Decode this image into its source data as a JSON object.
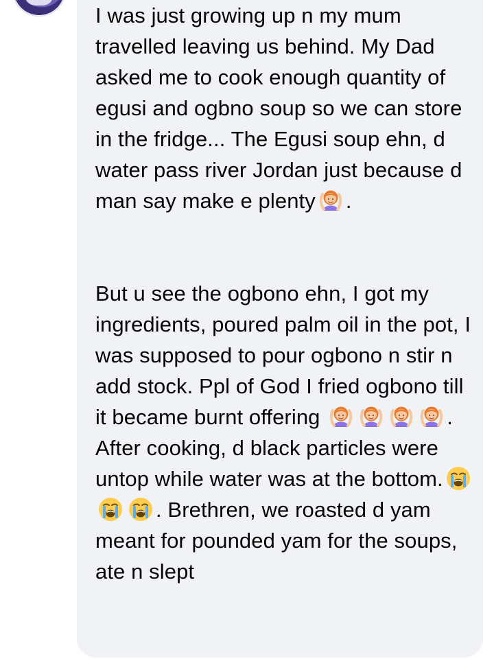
{
  "message": {
    "paragraph_1": {
      "text": "I was just growing up n my mum travelled leaving us behind. My Dad asked me to cook enough quantity of egusi and ogbno soup so we can store in the fridge... The Egusi soup ehn, d water pass river Jordan just because d man say make e plenty",
      "emoji_1": "woman-gesturing-ok",
      "end": "."
    },
    "paragraph_2": {
      "text_a": "But u see the ogbono ehn, I got my ingredients, poured palm oil in the pot, I was supposed to pour ogbono n stir n add stock. Ppl of God I fried ogbono till it became burnt offering",
      "emoji_row": [
        "woman-gesturing-ok",
        "woman-gesturing-ok",
        "woman-gesturing-ok",
        "woman-gesturing-ok"
      ],
      "text_b": ". After cooking, d black particles were untop while water was at the bottom.",
      "cry_row": [
        "loudly-crying-face",
        "loudly-crying-face",
        "loudly-crying-face"
      ],
      "text_c": ". Brethren, we roasted d yam meant for pounded yam for the soups, ate n slept"
    }
  },
  "colors": {
    "bubble": "#f0f2f5",
    "text": "#050505",
    "emoji_skin": "#f7c7a0",
    "emoji_hair": "#e77a2d",
    "emoji_shirt": "#8c74e8"
  }
}
